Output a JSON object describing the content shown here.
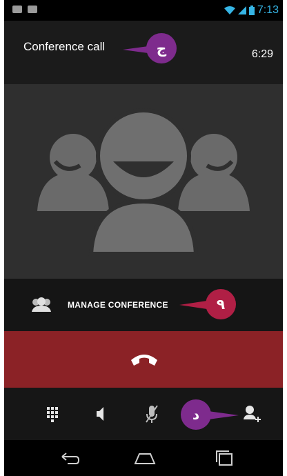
{
  "status_bar": {
    "time": "7:13",
    "icons": [
      "email-icon",
      "android-icon",
      "wifi-icon",
      "signal-icon",
      "battery-icon"
    ]
  },
  "header": {
    "title": "Conference call",
    "elapsed": "6:29"
  },
  "manage": {
    "label": "MANAGE CONFERENCE"
  },
  "callouts": [
    "ج",
    "۹",
    "د"
  ],
  "controls": [
    "dialpad-icon",
    "speaker-icon",
    "mute-icon",
    "add-call-icon"
  ],
  "nav": [
    "back-icon",
    "home-icon",
    "recents-icon"
  ],
  "colors": {
    "accent": "#36b5e5",
    "end_call": "#8b2226",
    "callout_purple": "#7e2b8d",
    "callout_red": "#b01f45"
  }
}
